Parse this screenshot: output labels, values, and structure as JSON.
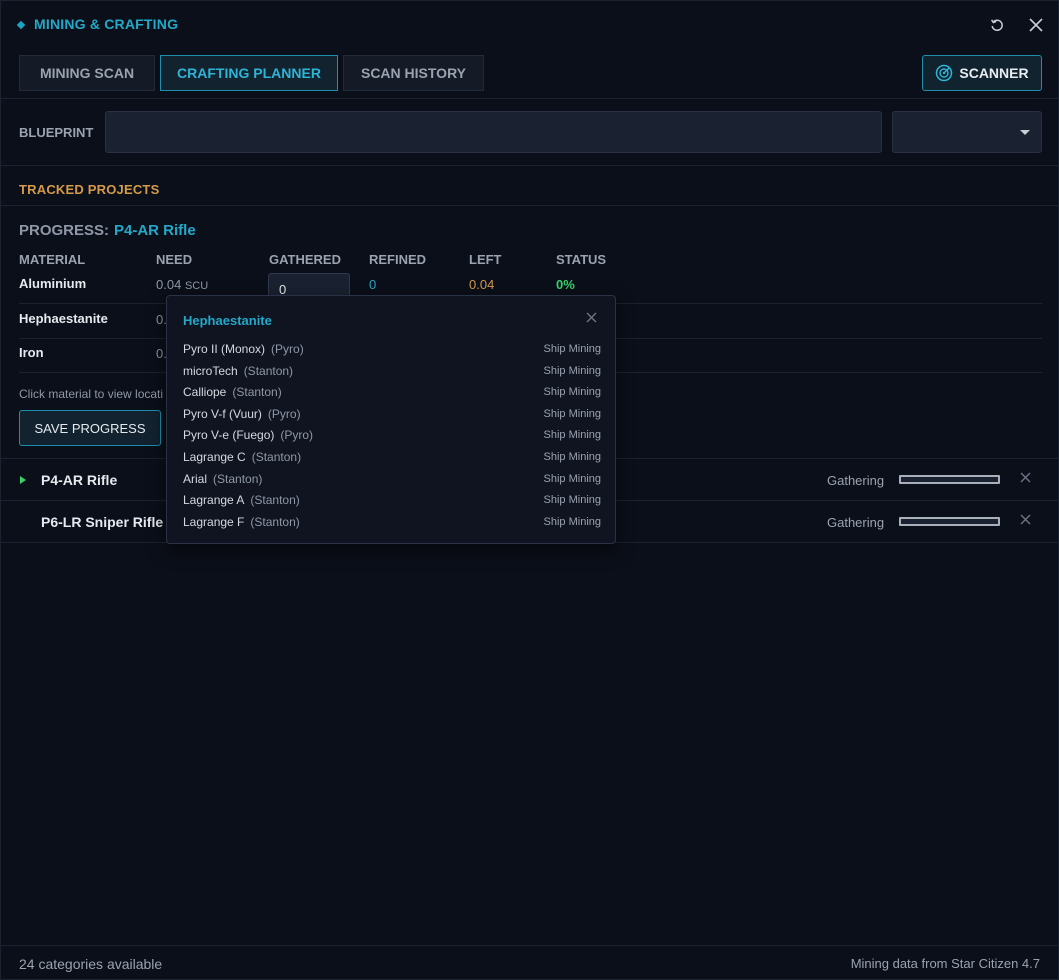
{
  "window": {
    "title": "MINING & CRAFTING"
  },
  "tabs": [
    {
      "label": "MINING SCAN",
      "active": false
    },
    {
      "label": "CRAFTING PLANNER",
      "active": true
    },
    {
      "label": "SCAN HISTORY",
      "active": false
    }
  ],
  "scanner_button": {
    "label": "SCANNER"
  },
  "blueprint": {
    "label": "BLUEPRINT",
    "value": "",
    "select_value": ""
  },
  "tracked": {
    "title": "TRACKED PROJECTS",
    "progress_label": "PROGRESS:",
    "progress_project": "P4-AR Rifle",
    "columns": [
      "MATERIAL",
      "NEED",
      "GATHERED",
      "REFINED",
      "LEFT",
      "STATUS"
    ],
    "materials": [
      {
        "name": "Aluminium",
        "need": "0.04",
        "unit": "SCU",
        "gathered": "0",
        "refined": "0",
        "left": "0.04",
        "status": "0%"
      },
      {
        "name": "Hephaestanite",
        "need": "0."
      },
      {
        "name": "Iron",
        "need": "0."
      }
    ],
    "hint": "Click material to view locati",
    "save_label": "SAVE PROGRESS",
    "projects": [
      {
        "name": "P4-AR Rifle",
        "state": "Gathering",
        "progress": 0,
        "playing": true
      },
      {
        "name": "P6-LR Sniper Rifle",
        "state": "Gathering",
        "progress": 0,
        "playing": false
      }
    ]
  },
  "popup": {
    "title": "Hephaestanite",
    "locations": [
      {
        "name": "Pyro II (Monox)",
        "system": "(Pyro)",
        "type": "Ship Mining"
      },
      {
        "name": "microTech",
        "system": "(Stanton)",
        "type": "Ship Mining"
      },
      {
        "name": "Calliope",
        "system": "(Stanton)",
        "type": "Ship Mining"
      },
      {
        "name": "Pyro V-f (Vuur)",
        "system": "(Pyro)",
        "type": "Ship Mining"
      },
      {
        "name": "Pyro V-e (Fuego)",
        "system": "(Pyro)",
        "type": "Ship Mining"
      },
      {
        "name": "Lagrange C",
        "system": "(Stanton)",
        "type": "Ship Mining"
      },
      {
        "name": "Arial",
        "system": "(Stanton)",
        "type": "Ship Mining"
      },
      {
        "name": "Lagrange A",
        "system": "(Stanton)",
        "type": "Ship Mining"
      },
      {
        "name": "Lagrange F",
        "system": "(Stanton)",
        "type": "Ship Mining"
      }
    ]
  },
  "footer": {
    "left": "24 categories available",
    "right": "Mining data from Star Citizen 4.7"
  },
  "colors": {
    "accent": "#22a9c9",
    "section": "#d59a4a",
    "success": "#35d46a",
    "background": "#0b0f19"
  },
  "icons": {
    "reset": "reset-icon",
    "close": "close-icon",
    "scanner": "radar-icon",
    "caret": "chevron-down-icon",
    "play": "play-icon"
  }
}
